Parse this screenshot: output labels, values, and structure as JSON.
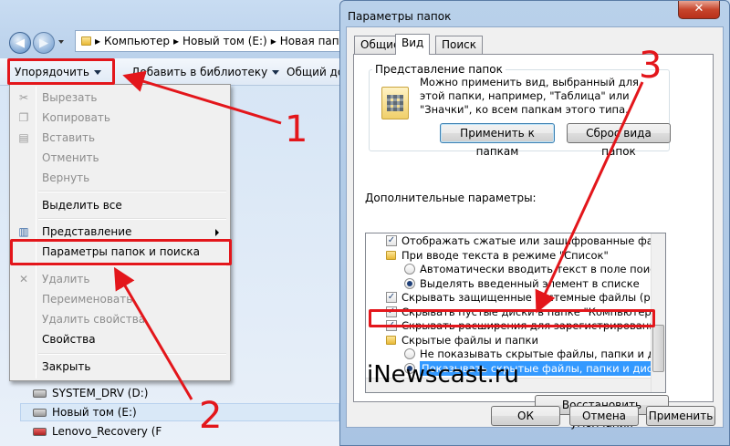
{
  "explorer": {
    "breadcrumb": [
      "Компьютер",
      "Новый том (E:)",
      "Новая папк"
    ],
    "toolbar": {
      "organize": "Упорядочить",
      "add_to_library": "Добавить в библиотеку",
      "share": "Общий до"
    },
    "menu": {
      "cut": "Вырезать",
      "copy": "Копировать",
      "paste": "Вставить",
      "undo": "Отменить",
      "redo": "Вернуть",
      "select_all": "Выделить все",
      "view": "Представление",
      "folder_options": "Параметры папок и поиска",
      "delete": "Удалить",
      "rename": "Переименовать",
      "remove_properties": "Удалить свойства",
      "properties": "Свойства",
      "close": "Закрыть"
    },
    "tree": [
      "SYSTEM_DRV (D:)",
      "Новый том (E:)",
      "Lenovo_Recovery (F"
    ]
  },
  "dialog": {
    "title": "Параметры папок",
    "close_glyph": "✕",
    "tabs": [
      "Общие",
      "Вид",
      "Поиск"
    ],
    "active_tab": "Вид",
    "folder_view": {
      "label": "Представление папок",
      "description": "Можно применить вид, выбранный для этой папки, например, \"Таблица\" или \"Значки\", ко всем папкам этого типа.",
      "apply_button": "Применить к папкам",
      "reset_button": "Сброс вида папок"
    },
    "advanced_label": "Дополнительные параметры:",
    "advanced_items": [
      {
        "type": "checkbox",
        "checked": true,
        "indent": 1,
        "text": "Отображать сжатые или зашифрованные файлы NTF"
      },
      {
        "type": "folder",
        "indent": 1,
        "text": "При вводе текста в режиме \"Список\""
      },
      {
        "type": "radio",
        "checked": false,
        "indent": 2,
        "text": "Автоматически вводить текст в поле поиска"
      },
      {
        "type": "radio",
        "checked": true,
        "indent": 2,
        "text": "Выделять введенный элемент в списке"
      },
      {
        "type": "checkbox",
        "checked": true,
        "indent": 1,
        "text": "Скрывать защищенные системные файлы (рекомен"
      },
      {
        "type": "checkbox",
        "checked": true,
        "indent": 1,
        "text": "Скрывать пустые диски в папке \"Компьютер\""
      },
      {
        "type": "checkbox",
        "checked": true,
        "indent": 1,
        "text": "Скрывать расширения для зарегистрированных типо"
      },
      {
        "type": "folder",
        "indent": 1,
        "text": "Скрытые файлы и папки"
      },
      {
        "type": "radio",
        "checked": false,
        "indent": 2,
        "text": "Не показывать скрытые файлы, папки и диски"
      },
      {
        "type": "radio",
        "checked": true,
        "indent": 2,
        "selected": true,
        "text": "Показывать скрытые файлы, папки и диски"
      }
    ],
    "restore_defaults": "Восстановить умолчания",
    "ok": "ОК",
    "cancel": "Отмена",
    "apply": "Применить"
  },
  "annotations": {
    "step1": "1",
    "step2": "2",
    "step3": "3",
    "watermark": "iNewscast.ru"
  },
  "colors": {
    "annotation_red": "#e3161b",
    "selection_blue": "#3399ff"
  }
}
